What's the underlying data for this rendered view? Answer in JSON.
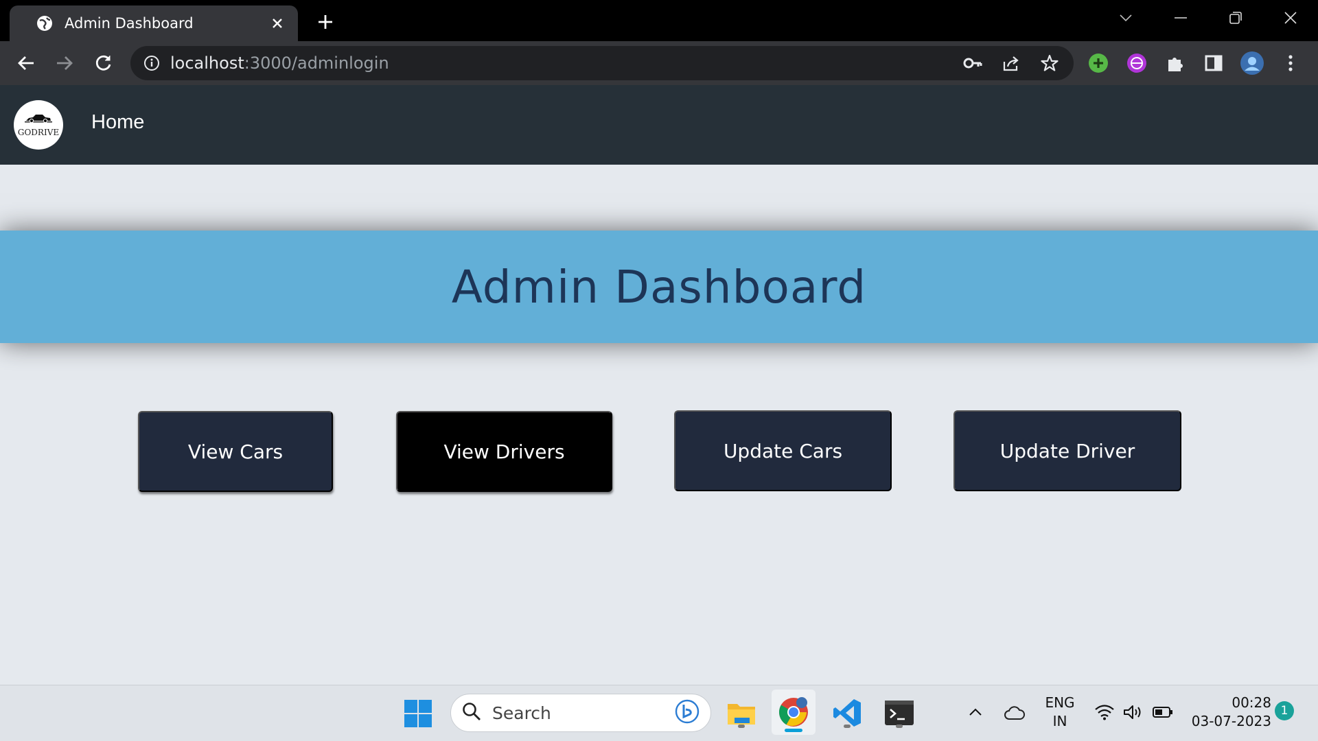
{
  "browser": {
    "tab_title": "Admin Dashboard",
    "url_host": "localhost",
    "url_path": ":3000/adminlogin"
  },
  "site": {
    "logo_text": "GODRIVE",
    "nav_home": "Home"
  },
  "page": {
    "title": "Admin Dashboard",
    "buttons": {
      "view_cars": "View Cars",
      "view_drivers": "View Drivers",
      "update_cars": "Update Cars",
      "update_driver": "Update Driver"
    }
  },
  "taskbar": {
    "search_placeholder": "Search",
    "language_line1": "ENG",
    "language_line2": "IN",
    "time": "00:28",
    "date": "03-07-2023",
    "notification_count": "1"
  },
  "colors": {
    "nav_bg": "#263038",
    "banner_bg": "#62afd7",
    "banner_text": "#1d3557",
    "button_navy": "#212a3d",
    "button_black": "#000000",
    "page_bg": "#e5e9ee"
  },
  "icons": [
    "globe-favicon-icon",
    "close-icon",
    "plus-icon",
    "chevron-down-icon",
    "minimize-icon",
    "restore-icon",
    "window-close-icon",
    "back-arrow-icon",
    "forward-arrow-icon",
    "reload-icon",
    "info-icon",
    "key-icon",
    "share-icon",
    "star-icon",
    "green-plus-extension-icon",
    "purple-extension-icon",
    "puzzle-icon",
    "side-panel-icon",
    "profile-avatar-icon",
    "kebab-menu-icon",
    "car-logo-icon",
    "windows-start-icon",
    "search-icon",
    "bing-icon",
    "file-explorer-icon",
    "chrome-icon",
    "vscode-icon",
    "terminal-icon",
    "chevron-up-icon",
    "cloud-icon",
    "wifi-icon",
    "volume-icon",
    "battery-icon"
  ]
}
